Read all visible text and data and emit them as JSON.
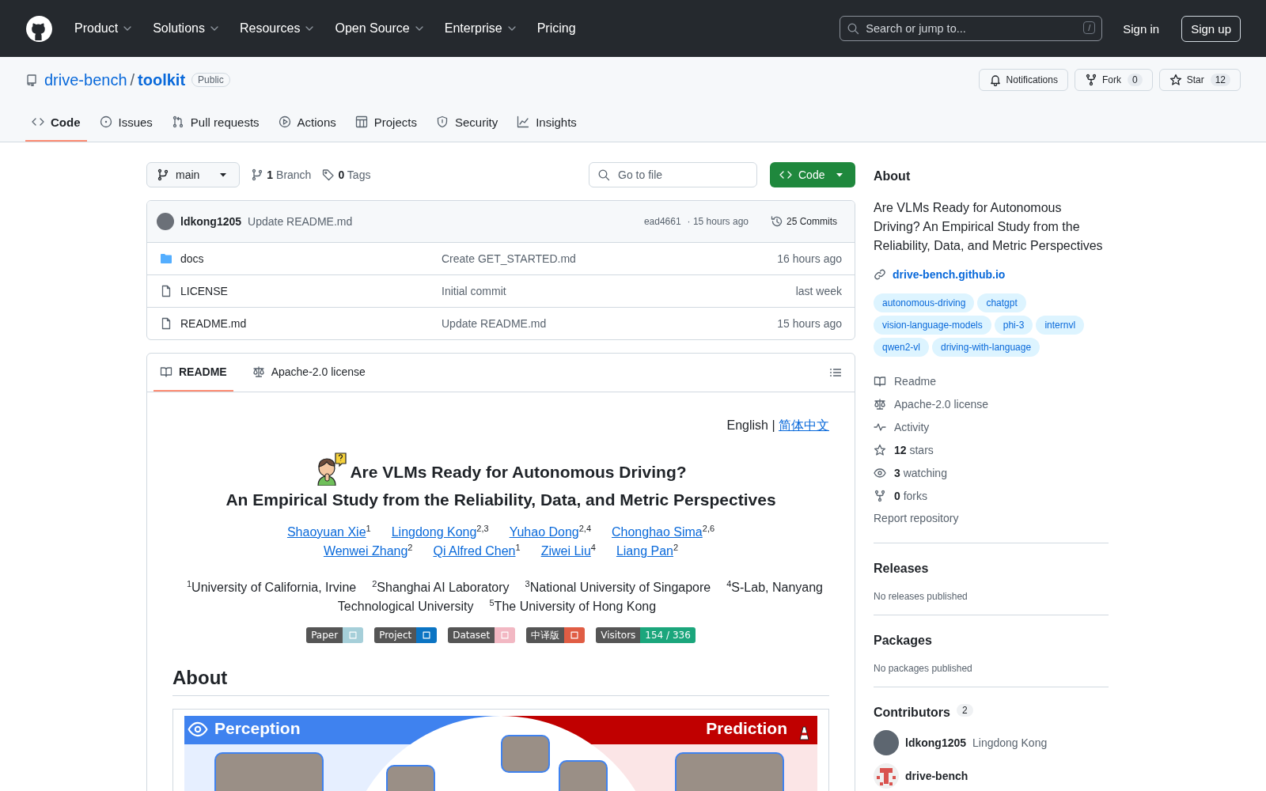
{
  "top_nav": {
    "menu": [
      {
        "label": "Product",
        "has_dropdown": true
      },
      {
        "label": "Solutions",
        "has_dropdown": true
      },
      {
        "label": "Resources",
        "has_dropdown": true
      },
      {
        "label": "Open Source",
        "has_dropdown": true
      },
      {
        "label": "Enterprise",
        "has_dropdown": true
      },
      {
        "label": "Pricing",
        "has_dropdown": false
      }
    ],
    "search": {
      "placeholder": "Search or jump to...",
      "shortcut": "/"
    },
    "sign_in": "Sign in",
    "sign_up": "Sign up"
  },
  "repo": {
    "owner": "drive-bench",
    "separator": "/",
    "name": "toolkit",
    "visibility": "Public",
    "actions": [
      {
        "kind": "notifications",
        "label": "Notifications"
      },
      {
        "kind": "fork",
        "label": "Fork",
        "count": "0"
      },
      {
        "kind": "star",
        "label": "Star",
        "count": "12"
      }
    ]
  },
  "tabs": [
    {
      "kind": "code",
      "label": "Code",
      "selected": true
    },
    {
      "kind": "issues",
      "label": "Issues",
      "selected": false
    },
    {
      "kind": "pulls",
      "label": "Pull requests",
      "selected": false
    },
    {
      "kind": "actions",
      "label": "Actions",
      "selected": false
    },
    {
      "kind": "projects",
      "label": "Projects",
      "selected": false
    },
    {
      "kind": "security",
      "label": "Security",
      "selected": false
    },
    {
      "kind": "insights",
      "label": "Insights",
      "selected": false
    }
  ],
  "file_browser": {
    "branch": "main",
    "branches": "**1** Branch",
    "tags": "**0** Tags",
    "search": {
      "placeholder": "Go to file"
    },
    "code_button": "Code",
    "latest_commit": {
      "author": "ldkong1205",
      "message": "Update README.md",
      "hash": "ead4661",
      "time": "· 15 hours ago",
      "commits": "25 Commits"
    },
    "files": [
      {
        "kind": "folder",
        "name": "docs",
        "message": "Create GET_STARTED.md",
        "time": "16 hours ago"
      },
      {
        "kind": "file",
        "name": "LICENSE",
        "message": "Initial commit",
        "time": "last week"
      },
      {
        "kind": "file",
        "name": "README.md",
        "message": "Update README.md",
        "time": "15 hours ago"
      }
    ]
  },
  "readme": {
    "tabs": [
      {
        "kind": "readme",
        "label": "README",
        "selected": true
      },
      {
        "kind": "license",
        "label": "Apache-2.0 license",
        "selected": false
      }
    ],
    "language": {
      "current": "English |",
      "other": "简体中文"
    },
    "title_lines": [
      "Are VLMs Ready for Autonomous Driving?",
      "An Empirical Study from the Reliability, Data, and Metric Perspectives"
    ],
    "author_lines": [
      [
        {
          "name": "Shaoyuan Xie",
          "marks": "1"
        },
        {
          "name": "Lingdong Kong",
          "marks": "2,3"
        },
        {
          "name": "Yuhao Dong",
          "marks": "2,4"
        },
        {
          "name": "Chonghao Sima",
          "marks": "2,6"
        }
      ],
      [
        {
          "name": "Wenwei Zhang",
          "marks": "2"
        },
        {
          "name": "Qi Alfred Chen",
          "marks": "1"
        },
        {
          "name": "Ziwei Liu",
          "marks": "4"
        },
        {
          "name": "Liang Pan",
          "marks": "2"
        }
      ]
    ],
    "affiliations": [
      "$^{1}$University of California, Irvine",
      "$^{2}$Shanghai AI Laboratory",
      "$^{3}$National University of Singapore",
      "$^{4}$S-Lab, Nanyang Technological University",
      "$^{5}$The University of Hong Kong"
    ],
    "badges": [
      {
        "label": "Paper",
        "color": "#a6cfd9"
      },
      {
        "label": "Project",
        "color": "#0b74c3"
      },
      {
        "label": "Dataset",
        "color": "#f2b8c3"
      },
      {
        "label": "中译版",
        "color": "#e05d44"
      },
      {
        "label": "Visitors",
        "value": "154 / 336",
        "color": "#1ba67c"
      }
    ],
    "section_heading": "About",
    "figure": {
      "left_label": "Perception",
      "right_label": "Prediction"
    }
  },
  "sidebar": {
    "about": {
      "heading": "About",
      "description": "Are VLMs Ready for Autonomous Driving? An Empirical Study from the Reliability, Data, and Metric Perspectives",
      "website": "drive-bench.github.io",
      "topics": [
        "autonomous-driving",
        "chatgpt",
        "vision-language-models",
        "phi-3",
        "internvl",
        "qwen2-vl",
        "driving-with-language"
      ],
      "stats": [
        {
          "kind": "readme",
          "text": "Readme"
        },
        {
          "kind": "license",
          "text": "Apache-2.0 license"
        },
        {
          "kind": "activity",
          "text": "Activity"
        },
        {
          "kind": "stars",
          "text": "**12** stars"
        },
        {
          "kind": "watching",
          "text": "**3** watching"
        },
        {
          "kind": "forks",
          "text": "**0** forks"
        }
      ],
      "report": "Report repository"
    },
    "releases": {
      "heading": "Releases",
      "note": "No releases published"
    },
    "packages": {
      "heading": "Packages",
      "note": "No packages published"
    },
    "contributors": {
      "heading": "Contributors",
      "count": "2",
      "people": [
        {
          "kind": "photo",
          "login": "ldkong1205",
          "name": "Lingdong Kong"
        },
        {
          "kind": "identicon",
          "login": "drive-bench"
        }
      ]
    }
  }
}
